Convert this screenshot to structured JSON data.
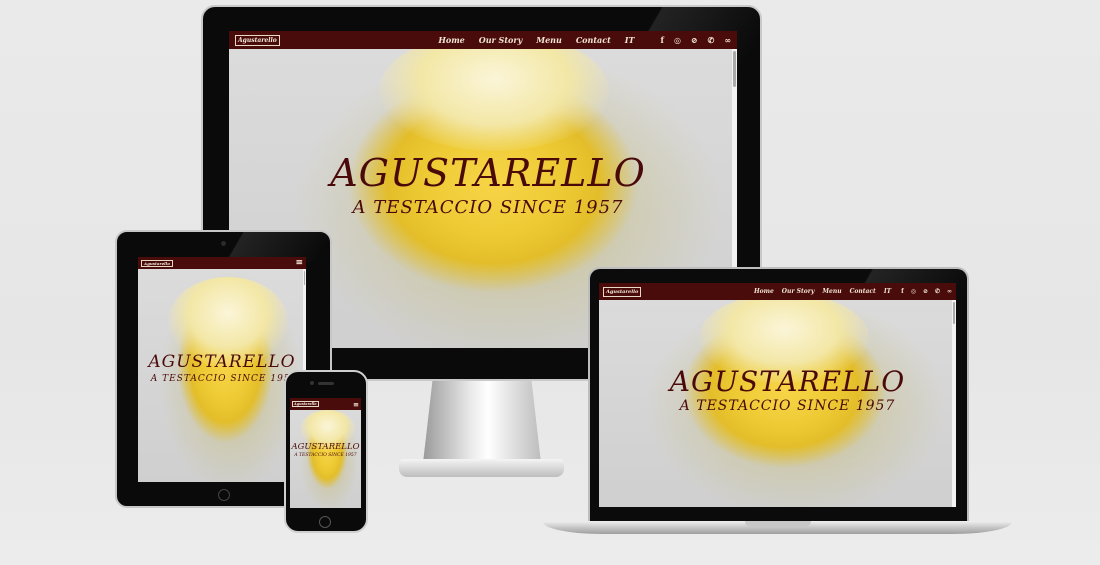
{
  "site": {
    "brand": "Agustarello",
    "nav": [
      "Home",
      "Our Story",
      "Menu",
      "Contact",
      "IT"
    ],
    "social_icons": [
      "facebook-icon",
      "instagram-icon",
      "tripadvisor-icon",
      "whatsapp-icon",
      "thefork-icon"
    ],
    "social_glyphs": [
      "f",
      "◎",
      "⊘",
      "✆",
      "∞"
    ],
    "hero_title": "AGUSTARELLO",
    "hero_subtitle": "A TESTACCIO SINCE 1957",
    "menu_glyph": "≡"
  },
  "colors": {
    "navbar": "#4a0b0b",
    "hero_text": "#4b0a0a",
    "nav_text": "#f1e6d6"
  }
}
